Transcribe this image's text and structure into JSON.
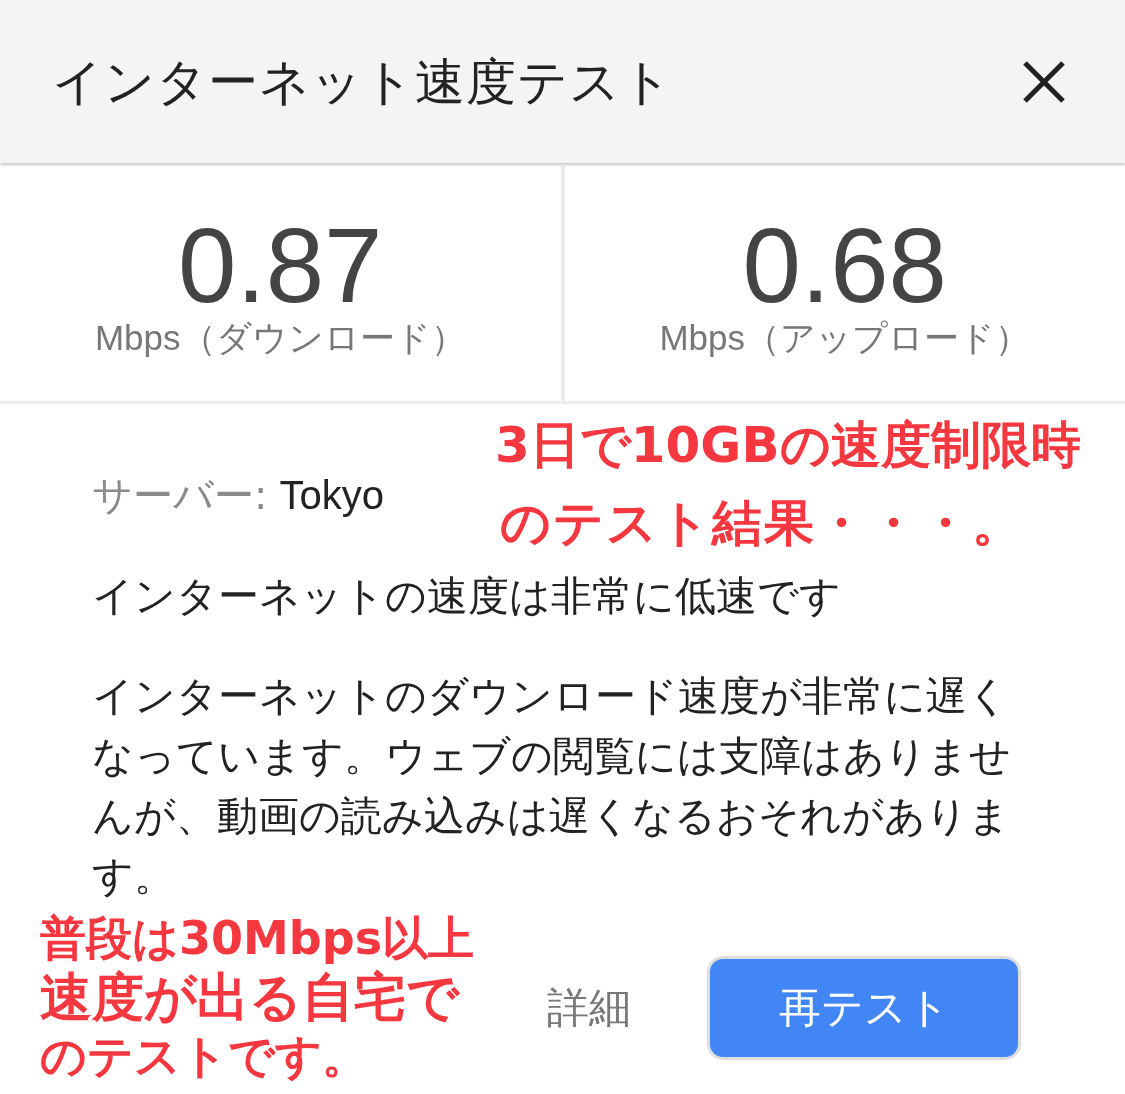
{
  "dialog": {
    "title": "インターネット速度テスト"
  },
  "results": [
    {
      "value": "0.87",
      "unit": "Mbps（ダウンロード）"
    },
    {
      "value": "0.68",
      "unit": "Mbps（アップロード）"
    }
  ],
  "server": {
    "label": "サーバー:",
    "value": "Tokyo"
  },
  "status": "インターネットの速度は非常に低速です",
  "description": "インターネットのダウンロード速度が非常に遅くなっています。ウェブの閲覧には支障はありませんが、動画の読み込みは遅くなるおそれがあります。",
  "buttons": [
    {
      "label": "詳細",
      "kind": "text"
    },
    {
      "label": "再テスト",
      "kind": "primary"
    }
  ],
  "annotation": {
    "lines": [
      "3日で10GBの速度制限時",
      "のテスト結果・・・。",
      "普段は30Mbps以上",
      "速度が出る自宅で",
      "のテストです。"
    ]
  }
}
